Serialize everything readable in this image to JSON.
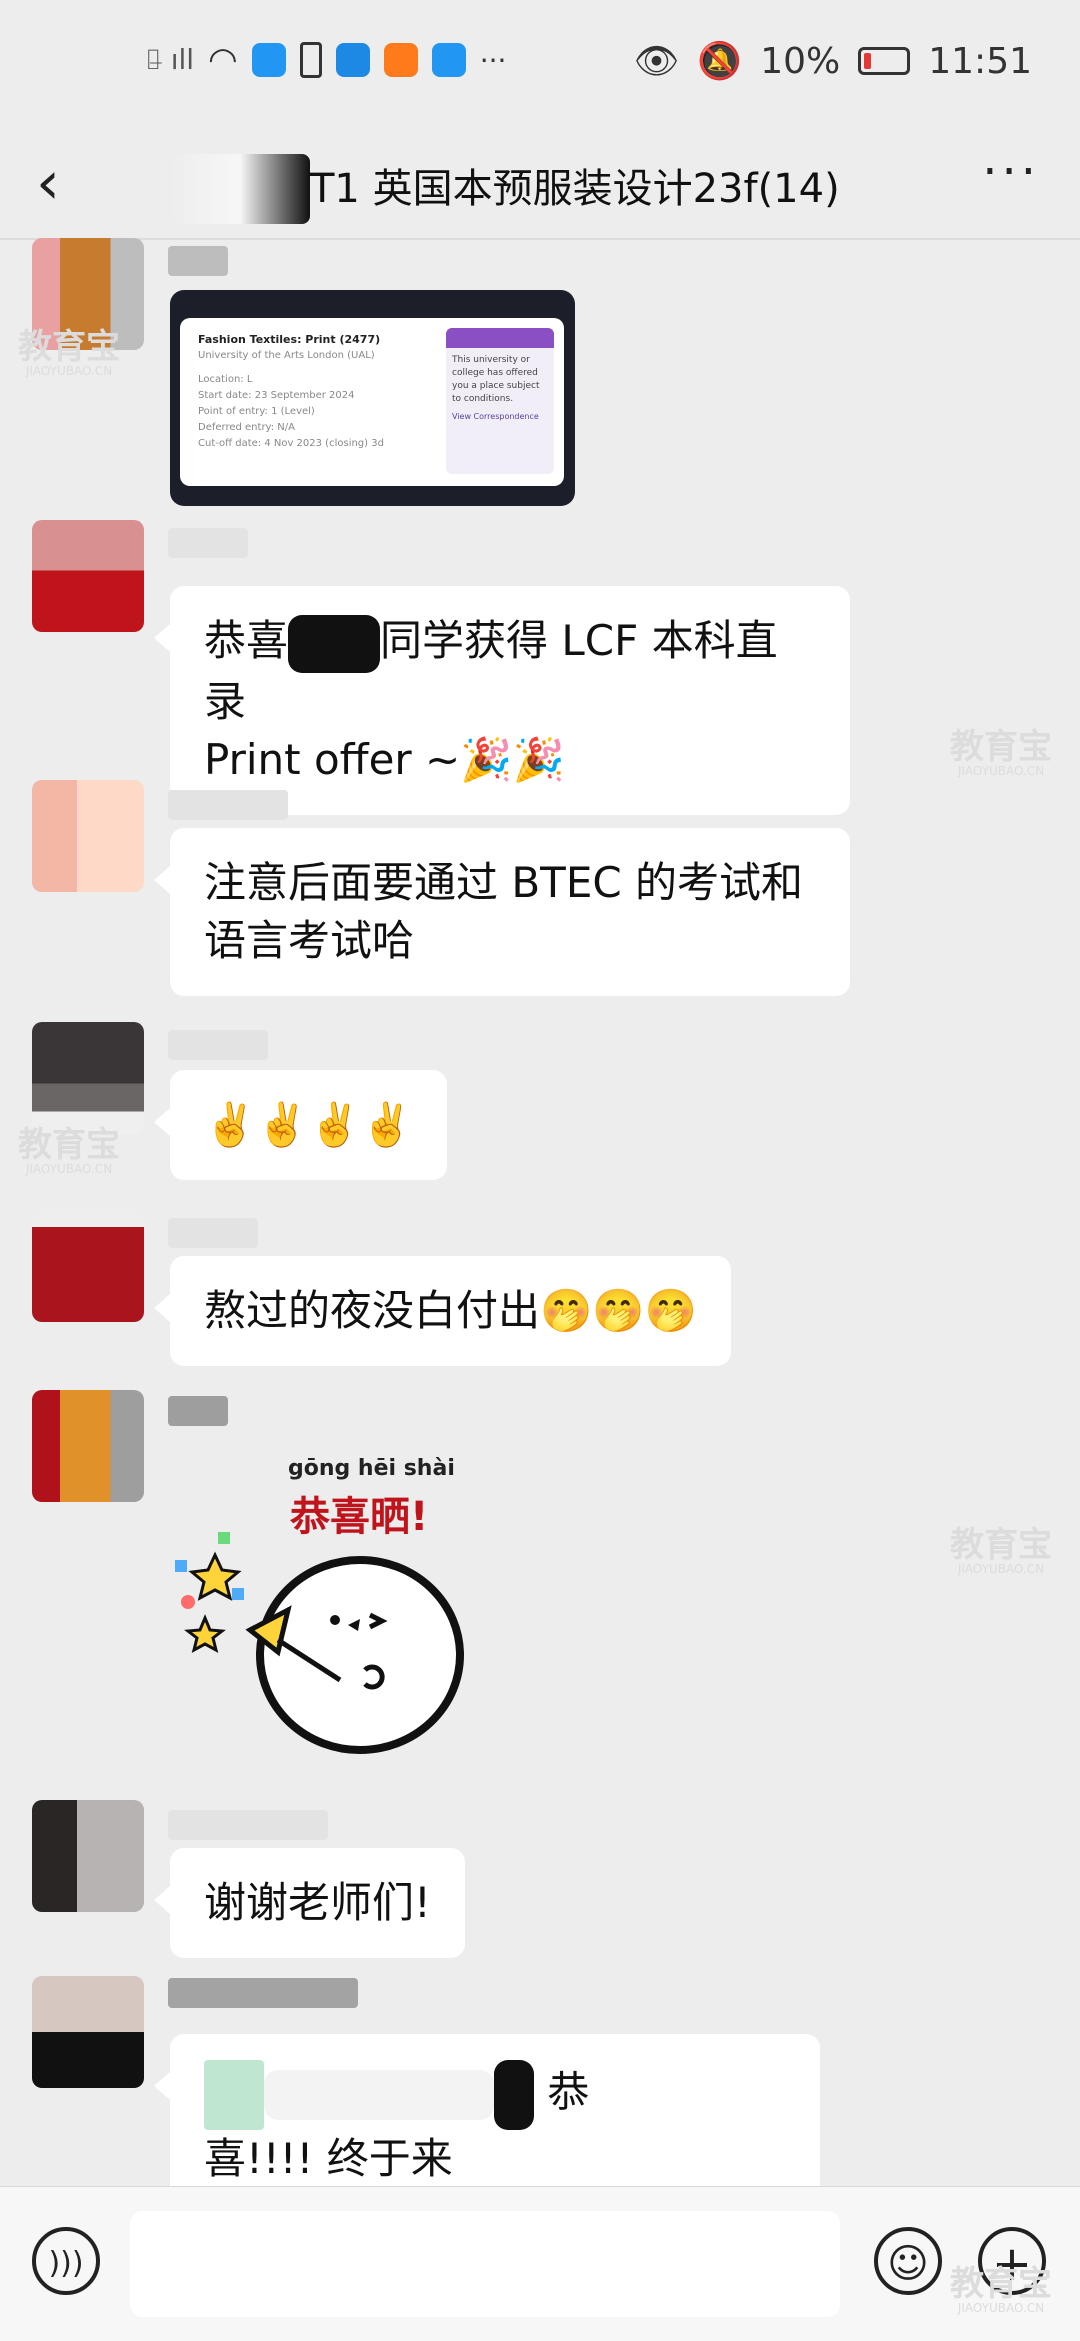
{
  "status": {
    "battery": "10%",
    "time": "11:51",
    "colors": {
      "battery": "#e53935",
      "alipay": "#1e88e5",
      "video": "#ff7a1a",
      "weather": "#2196f3",
      "shield": "#2196f3"
    }
  },
  "header": {
    "title": "T1 英国本预服装设计23f(14)"
  },
  "card": {
    "title": "Fashion Textiles: Print (2477)",
    "subtitle": "University of the Arts London (UAL)",
    "lines": [
      "Location: L",
      "Start date: 23 September 2024",
      "Point of entry: 1 (Level)",
      "Deferred entry: N/A",
      "Cut-off date: 4 Nov 2023 (closing) 3d",
      ""
    ],
    "status_lines": [
      "This university or college has offered you a place subject to conditions.",
      "",
      "",
      "View Correspondence"
    ]
  },
  "messages": [
    {
      "parts": [
        "恭喜",
        "同学获得 LCF 本科直录",
        "Print offer ~🎉🎉"
      ]
    },
    {
      "text": "注意后面要通过 BTEC 的考试和语言考试哈"
    },
    {
      "text": "✌️✌️✌️✌️"
    },
    {
      "text": "熬过的夜没白付出🤭🤭🤭"
    },
    {
      "sticker_pinyin": "gōng hēi shài",
      "sticker_text": "恭喜晒!"
    },
    {
      "text": "谢谢老师们!"
    },
    {
      "parts": [
        "恭",
        "喜!!!! 终于来"
      ]
    }
  ],
  "watermark": {
    "main": "教育宝",
    "sub": "JIAOYUBAO.CN"
  }
}
